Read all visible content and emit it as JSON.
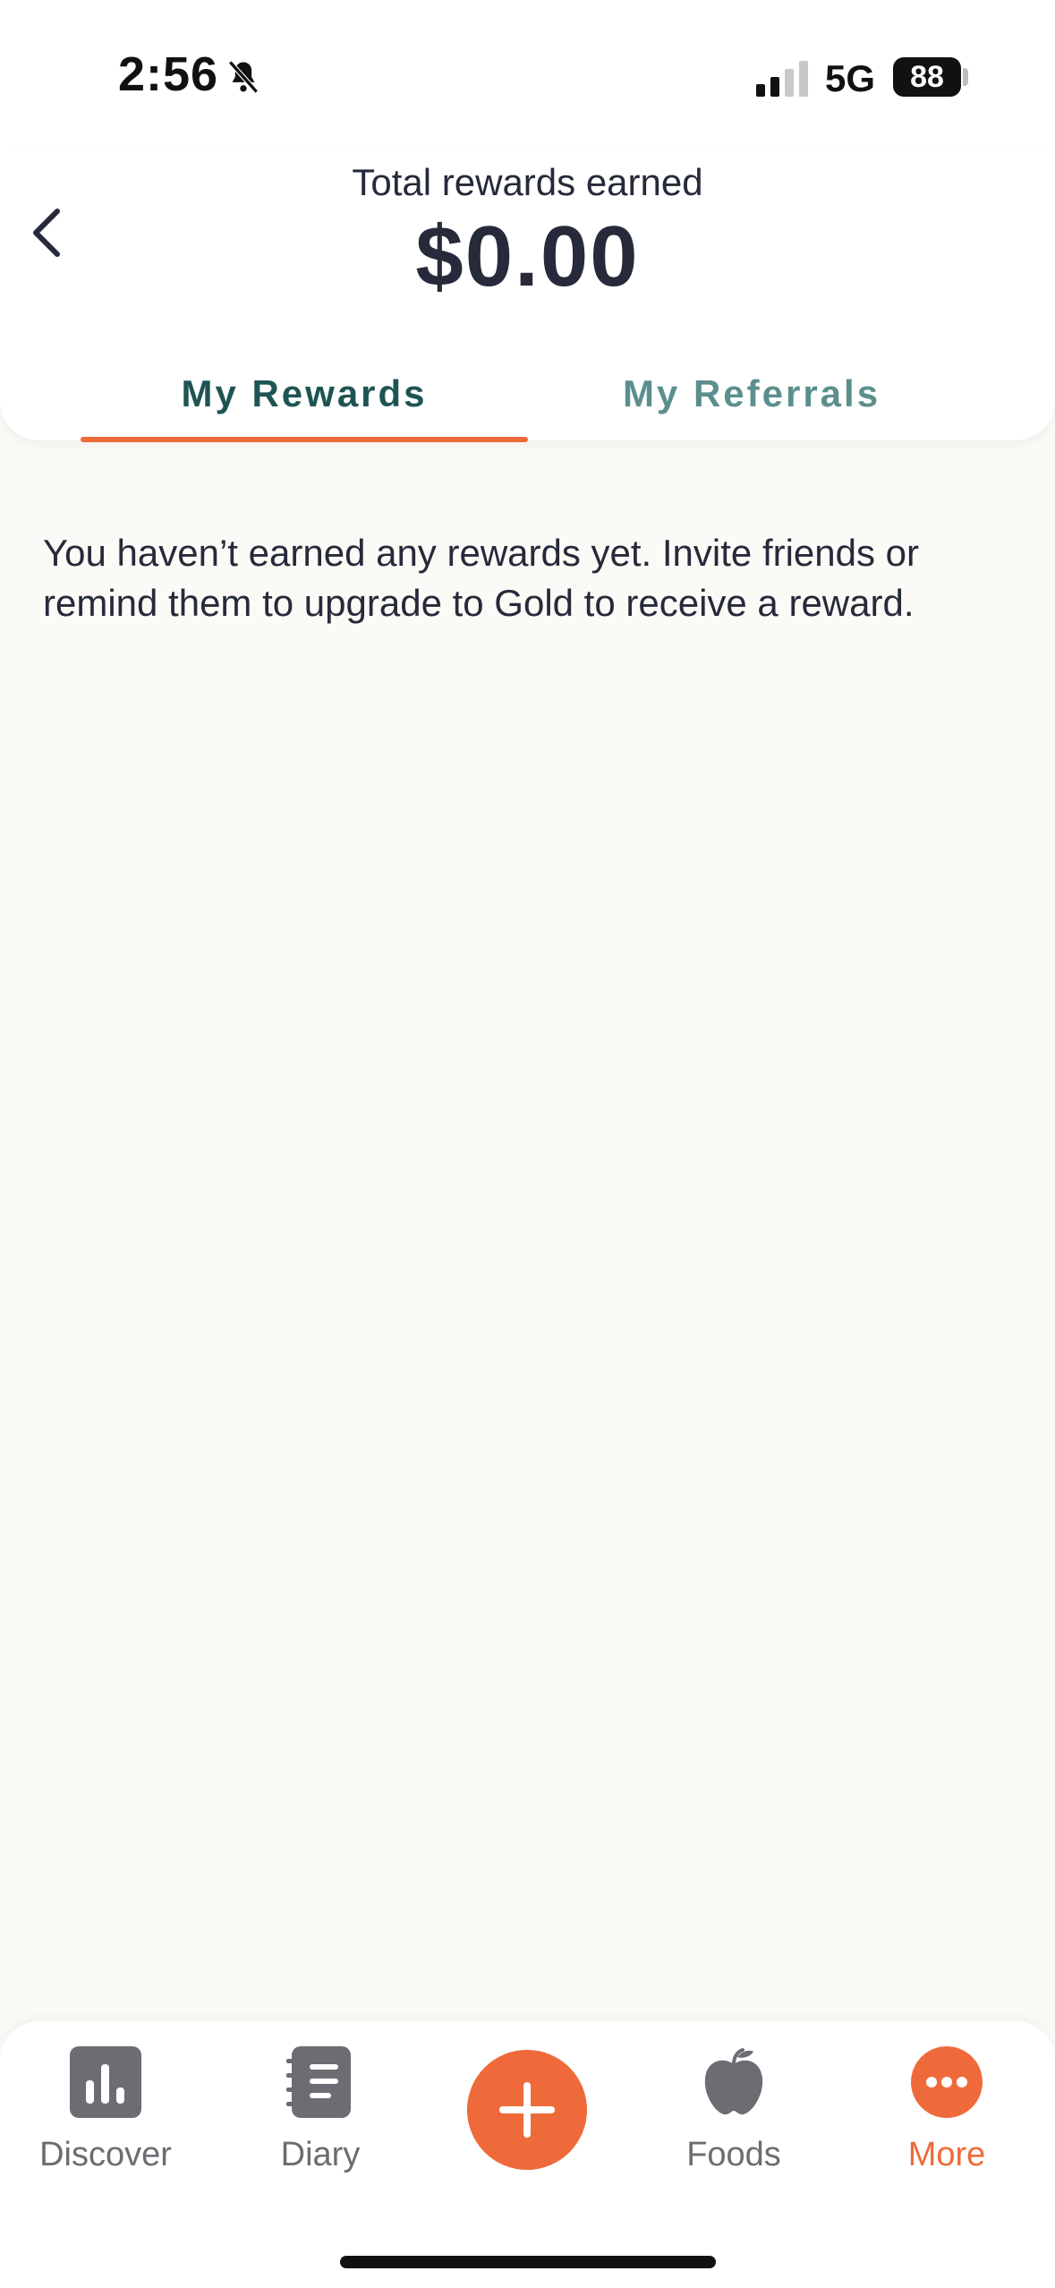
{
  "status_bar": {
    "time": "2:56",
    "network": "5G",
    "battery": "88"
  },
  "header": {
    "label": "Total rewards earned",
    "amount": "$0.00"
  },
  "tabs": [
    {
      "label": "My Rewards",
      "active": true
    },
    {
      "label": "My Referrals",
      "active": false
    }
  ],
  "content": {
    "empty_message": "You haven’t earned any rewards yet. Invite friends or remind them to upgrade to Gold to receive a reward."
  },
  "bottom_nav": {
    "items": [
      {
        "label": "Discover",
        "icon": "bar-chart-icon"
      },
      {
        "label": "Diary",
        "icon": "notebook-icon"
      },
      {
        "label": "Foods",
        "icon": "apple-icon"
      },
      {
        "label": "More",
        "icon": "more-dots-icon",
        "active": true
      }
    ],
    "add_icon": "plus-icon"
  },
  "colors": {
    "accent": "#ef6a3a",
    "teal_active": "#1f5454",
    "teal_inactive": "#5b8f8e",
    "background": "#fbfaf6"
  }
}
